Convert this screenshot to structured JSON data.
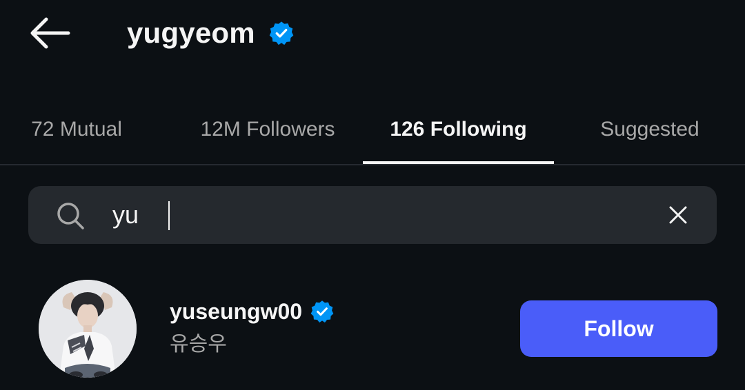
{
  "header": {
    "title": "yugyeom",
    "title_verified": true
  },
  "tabs": [
    {
      "label": "72 Mutual",
      "active": false
    },
    {
      "label": "12M Followers",
      "active": false
    },
    {
      "label": "126 Following",
      "active": true
    },
    {
      "label": "Suggested",
      "active": false
    }
  ],
  "search": {
    "value": "yu",
    "placeholder": "Search"
  },
  "results": [
    {
      "username": "yuseungw00",
      "verified": true,
      "full_name": "유승우",
      "action_label": "Follow"
    }
  ],
  "colors": {
    "background": "#0c1014",
    "verified_blue": "#0095f6",
    "follow_button": "#4a5df9",
    "search_bg": "#25292e",
    "muted_text": "#a8a8a8"
  },
  "icons": {
    "back": "arrow-left-icon",
    "verified": "verified-badge-icon",
    "search": "search-icon",
    "clear": "close-icon"
  }
}
